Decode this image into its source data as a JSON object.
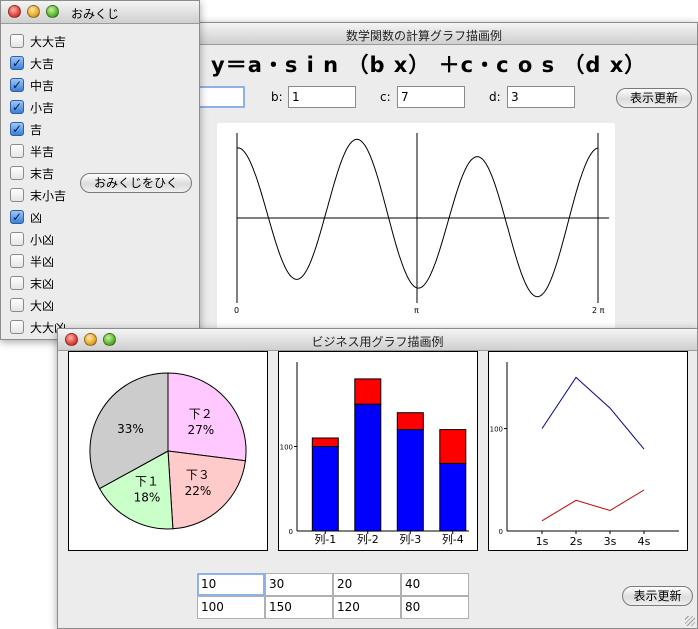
{
  "omikuji": {
    "title": "おみくじ",
    "button_label": "おみくじをひく",
    "items": [
      {
        "label": "大大吉",
        "checked": false
      },
      {
        "label": "大吉",
        "checked": true
      },
      {
        "label": "中吉",
        "checked": true
      },
      {
        "label": "小吉",
        "checked": true
      },
      {
        "label": "吉",
        "checked": true
      },
      {
        "label": "半吉",
        "checked": false
      },
      {
        "label": "末吉",
        "checked": false
      },
      {
        "label": "末小吉",
        "checked": false
      },
      {
        "label": "凶",
        "checked": true
      },
      {
        "label": "小凶",
        "checked": false
      },
      {
        "label": "半凶",
        "checked": false
      },
      {
        "label": "末凶",
        "checked": false
      },
      {
        "label": "大凶",
        "checked": false
      },
      {
        "label": "大大凶",
        "checked": false
      }
    ]
  },
  "math": {
    "title": "数学関数の計算グラフ描画例",
    "formula": "y＝a・s i n （b x） ＋c・c o s （d x）",
    "fields": {
      "a_value": "",
      "b_label": "b:",
      "b_value": "1",
      "c_label": "c:",
      "c_value": "7",
      "d_label": "d:",
      "d_value": "3"
    },
    "refresh_label": "表示更新",
    "axis_labels": {
      "zero": "0",
      "pi": "π",
      "two_pi": "2 π"
    }
  },
  "business": {
    "title": "ビジネス用グラフ描画例",
    "refresh_label": "表示更新",
    "table": [
      [
        "10",
        "30",
        "20",
        "40"
      ],
      [
        "100",
        "150",
        "120",
        "80"
      ]
    ]
  },
  "chart_data": [
    {
      "type": "line",
      "function": "a*sin(b*x) + c*cos(d*x)",
      "b": 1,
      "c": 7,
      "d": 3,
      "xlim": [
        0,
        6.283
      ],
      "tick_labels": [
        "0",
        "π",
        "2 π"
      ]
    },
    {
      "type": "pie",
      "slices": [
        {
          "label": "下２",
          "value": 27,
          "color": "#ffc8ff"
        },
        {
          "label": "下３",
          "value": 22,
          "color": "#ffcaca"
        },
        {
          "label": "下１",
          "value": 18,
          "color": "#caffca"
        },
        {
          "label": "",
          "value": 33,
          "color": "#cccccc"
        }
      ],
      "percent_labels": [
        "27%",
        "22%",
        "18%",
        "33%"
      ],
      "slice_labels": [
        "下２",
        "下３",
        "下１",
        ""
      ]
    },
    {
      "type": "bar",
      "stacked": true,
      "categories": [
        "列-1",
        "列-2",
        "列-3",
        "列-4"
      ],
      "series": [
        {
          "values": [
            100,
            150,
            120,
            80
          ],
          "color": "#0000ff"
        },
        {
          "values": [
            10,
            30,
            20,
            40
          ],
          "color": "#ff0000"
        }
      ],
      "ytick": "100",
      "ylim": [
        0,
        200
      ]
    },
    {
      "type": "line",
      "categories": [
        "1s",
        "2s",
        "3s",
        "4s"
      ],
      "series": [
        {
          "values": [
            100,
            150,
            120,
            80
          ],
          "color": "#0000aa"
        },
        {
          "values": [
            10,
            30,
            20,
            40
          ],
          "color": "#cc0000"
        }
      ],
      "ytick": "100",
      "ylim": [
        0,
        165
      ]
    }
  ]
}
